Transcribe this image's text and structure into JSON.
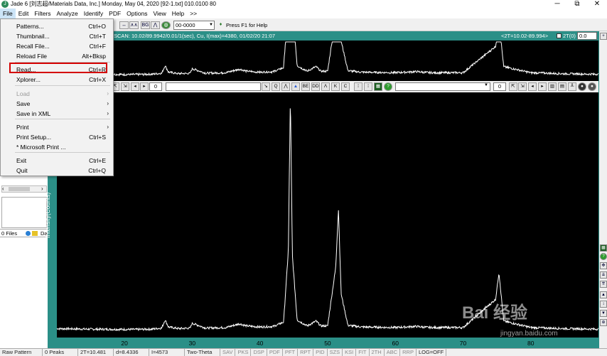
{
  "window": {
    "title": "Jade 6 [刘志超/Materials Data, Inc.] Monday, May 04, 2020 [92-1.txt] 010.0100 80",
    "minimize": "─",
    "restore": "⧉",
    "close": "✕"
  },
  "menubar": [
    "File",
    "Edit",
    "Filters",
    "Analyze",
    "Identify",
    "PDF",
    "Options",
    "View",
    "Help",
    ">>"
  ],
  "file_menu": {
    "items": [
      {
        "label": "Patterns...",
        "shortcut": "Ctrl+O"
      },
      {
        "label": "Thumbnail...",
        "shortcut": "Ctrl+T"
      },
      {
        "label": "Recall File...",
        "shortcut": "Ctrl+F"
      },
      {
        "label": "Reload File",
        "shortcut": "Alt+Bksp"
      },
      {
        "label": "Read...",
        "shortcut": "Ctrl+R"
      },
      {
        "label": "Xplorer...",
        "shortcut": "Ctrl+X"
      },
      {
        "label": "Load",
        "shortcut": ""
      },
      {
        "label": "Save",
        "shortcut": ""
      },
      {
        "label": "Save in XML",
        "shortcut": ""
      },
      {
        "label": "Print",
        "shortcut": ""
      },
      {
        "label": "Print Setup...",
        "shortcut": "Ctrl+S"
      },
      {
        "label": "* Microsoft Print ...",
        "shortcut": ""
      },
      {
        "label": "Exit",
        "shortcut": "Ctrl+E"
      },
      {
        "label": "Quit",
        "shortcut": "Ctrl+Q"
      }
    ]
  },
  "toolbar": {
    "pdf_value": "00-0000",
    "help_tip": "Press F1 for Help",
    "num_left": "0",
    "num_right": "0"
  },
  "overview": {
    "scan_info": "SCAN: 10.02/89.9942/0.01/1(sec), Cu, I(max)=4380, 01/02/20 21:07",
    "range": "<2T=10.02-89.994>",
    "twotheta_label": "2T(0)",
    "twotheta_value": "0.0"
  },
  "left_panel": {
    "files_label": "0 Files",
    "da_label": "Da"
  },
  "plot": {
    "ylabel": "Intensity(Counts)",
    "xticks": [
      "20",
      "30",
      "40",
      "50",
      "60",
      "70",
      "80"
    ]
  },
  "chart_data": {
    "type": "line",
    "title": "",
    "xlabel": "",
    "ylabel": "Intensity(Counts)",
    "xlim": [
      10.02,
      89.994
    ],
    "ylim": [
      0,
      4380
    ],
    "x": [
      10.02,
      15,
      20,
      22,
      24,
      25.5,
      26,
      26.5,
      28,
      29.7,
      30,
      32,
      35,
      37,
      38,
      40,
      42,
      43.5,
      44.2,
      44.5,
      44.8,
      45.5,
      47,
      48.3,
      49,
      50,
      51.2,
      51.6,
      52,
      53,
      55,
      60,
      63,
      65,
      70,
      74.8,
      75.3,
      76,
      80,
      85,
      89.99
    ],
    "values": [
      60,
      50,
      45,
      45,
      50,
      70,
      220,
      90,
      60,
      70,
      160,
      70,
      80,
      150,
      110,
      90,
      100,
      180,
      1500,
      4380,
      1400,
      220,
      110,
      200,
      110,
      110,
      1200,
      2280,
      700,
      120,
      90,
      80,
      100,
      80,
      80,
      600,
      1100,
      200,
      80,
      60,
      50
    ]
  },
  "statusbar": [
    "Raw Pattern",
    "0 Peaks",
    "2T=10.481",
    "d=8.4336",
    "I=4573",
    "Two-Theta",
    "SAV",
    "PKS",
    "DSP",
    "PDF",
    "PFT",
    "RPT",
    "PID",
    "SZS",
    "KSI",
    "FIT",
    "2TH",
    "ABC",
    "RRP",
    "LOG=OFF"
  ],
  "watermark": {
    "text": "Bai 经验",
    "url": "jingyan.baidu.com"
  },
  "colors": {
    "frame": "#2b8f87",
    "plot_bg": "#000000",
    "trace": "#ffffff",
    "highlight": "#d40000"
  }
}
